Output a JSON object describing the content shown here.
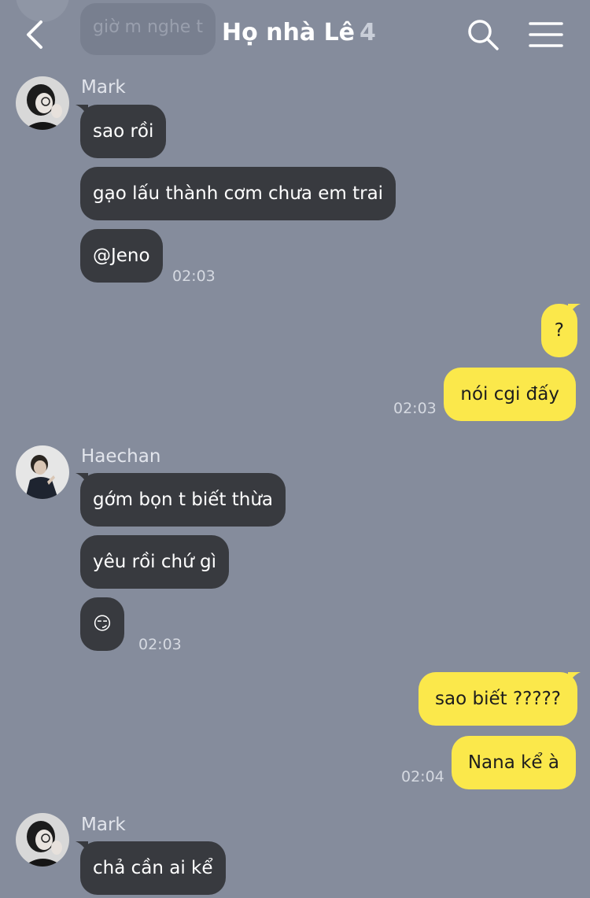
{
  "header": {
    "title": "Họ nhà Lê",
    "member_count": "4"
  },
  "previous_message": "giờ m nghe t",
  "messages": [
    {
      "sender": "Mark",
      "bubbles": [
        "sao rồi",
        "gạo lấu thành cơm chưa em trai",
        "@Jeno"
      ],
      "time": "02:03"
    },
    {
      "sender": "me",
      "bubbles": [
        "?",
        "nói cgi đấy"
      ],
      "time": "02:03"
    },
    {
      "sender": "Haechan",
      "bubbles": [
        "gớm bọn t biết thừa",
        "yêu rồi chứ gì",
        "😏"
      ],
      "time": "02:03"
    },
    {
      "sender": "me",
      "bubbles": [
        "sao biết ?????",
        "Nana kể à"
      ],
      "time": "02:04"
    },
    {
      "sender": "Mark",
      "bubbles": [
        "chả cần ai kể"
      ]
    }
  ],
  "colors": {
    "background": "#858c9c",
    "incoming_bubble": "#383a3f",
    "outgoing_bubble": "#fbe84b"
  }
}
